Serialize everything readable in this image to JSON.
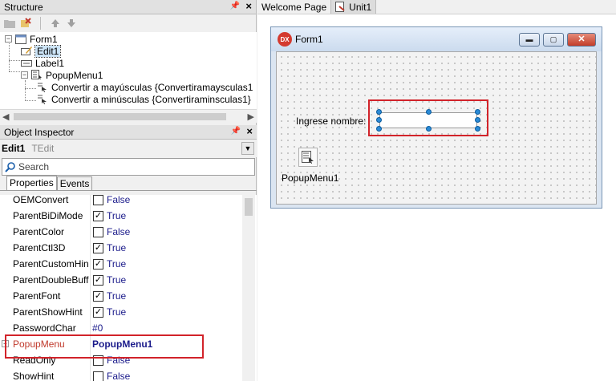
{
  "structure": {
    "title": "Structure",
    "tree": {
      "form": "Form1",
      "edit": "Edit1",
      "label": "Label1",
      "popup": "PopupMenu1",
      "item1": "Convertir a mayúsculas {Convertiramaysculas1",
      "item2": "Convertir a minúsculas {Convertiraminsculas1}"
    }
  },
  "inspector": {
    "title": "Object Inspector",
    "object_name": "Edit1",
    "object_type": "TEdit",
    "search_placeholder": "Search",
    "tabs": [
      "Properties",
      "Events"
    ],
    "properties": [
      {
        "name": "OEMConvert",
        "value": "False",
        "checkbox": true,
        "checked": false
      },
      {
        "name": "ParentBiDiMode",
        "value": "True",
        "checkbox": true,
        "checked": true
      },
      {
        "name": "ParentColor",
        "value": "False",
        "checkbox": true,
        "checked": false
      },
      {
        "name": "ParentCtl3D",
        "value": "True",
        "checkbox": true,
        "checked": true
      },
      {
        "name": "ParentCustomHin",
        "value": "True",
        "checkbox": true,
        "checked": true
      },
      {
        "name": "ParentDoubleBuff",
        "value": "True",
        "checkbox": true,
        "checked": true
      },
      {
        "name": "ParentFont",
        "value": "True",
        "checkbox": true,
        "checked": true
      },
      {
        "name": "ParentShowHint",
        "value": "True",
        "checkbox": true,
        "checked": true
      },
      {
        "name": "PasswordChar",
        "value": "#0",
        "checkbox": false,
        "checked": false
      },
      {
        "name": "PopupMenu",
        "value": "PopupMenu1",
        "checkbox": false,
        "checked": false,
        "highlight": true
      },
      {
        "name": "ReadOnly",
        "value": "False",
        "checkbox": true,
        "checked": false
      },
      {
        "name": "ShowHint",
        "value": "False",
        "checkbox": true,
        "checked": false
      }
    ]
  },
  "file_tabs": [
    "Welcome Page",
    "Unit1"
  ],
  "designer": {
    "form_title": "Form1",
    "dx_badge": "DX",
    "label_text": "Ingrese nombre:",
    "popup_caption": "PopupMenu1"
  },
  "colors": {
    "highlight_red": "#d2232a",
    "property_value": "#1b1b8b",
    "selection": "#cce4f7"
  }
}
